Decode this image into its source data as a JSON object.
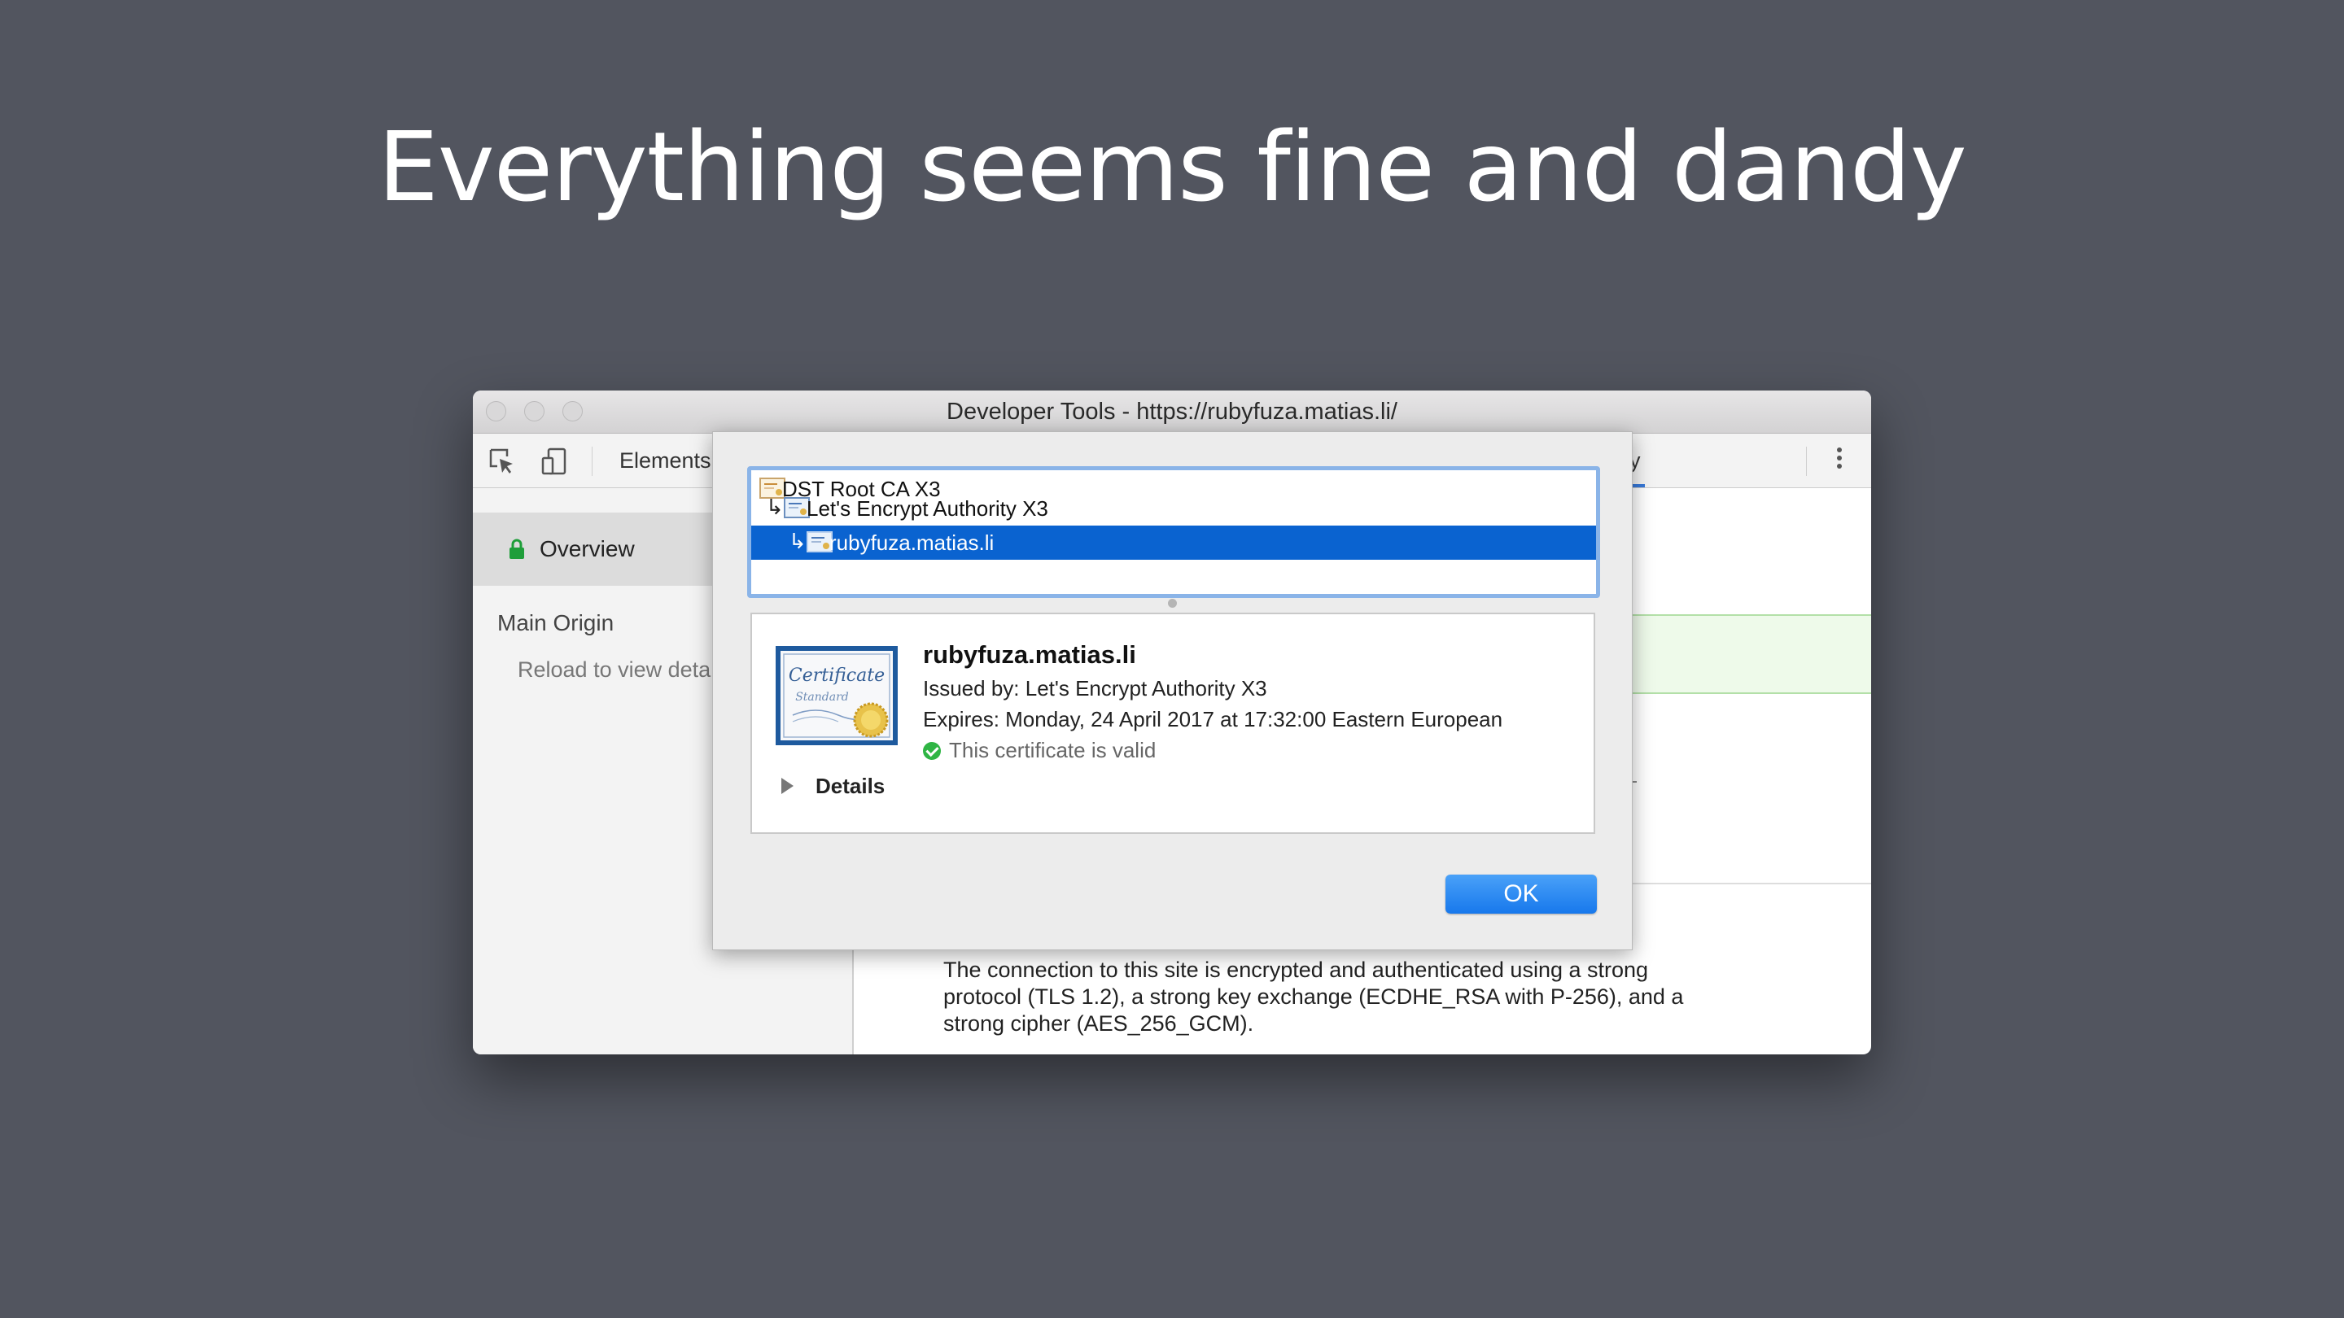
{
  "slide": {
    "title": "Everything seems fine and dandy"
  },
  "window": {
    "title": "Developer Tools - https://rubyfuza.matias.li/"
  },
  "toolbar": {
    "elements_tab": "Elements",
    "security_tab_partial": "y"
  },
  "sidebar": {
    "overview": "Overview",
    "main_origin": "Main Origin",
    "reload_text": "Reload to view deta"
  },
  "content": {
    "connection_text": "The connection to this site is encrypted and authenticated using a strong protocol (TLS 1.2), a strong key exchange (ECDHE_RSA with P-256), and a strong cipher (AES_256_GCM)."
  },
  "certificate": {
    "chain": [
      {
        "name": "DST Root CA X3",
        "arrow": ""
      },
      {
        "name": "Let's Encrypt Authority X3",
        "arrow": "↳"
      },
      {
        "name": "rubyfuza.matias.li",
        "arrow": "↳"
      }
    ],
    "selected_index": 2,
    "icon_text": {
      "line1": "Certificate",
      "line2": "Standard"
    },
    "name": "rubyfuza.matias.li",
    "issued_by": "Issued by: Let's Encrypt Authority X3",
    "expires": "Expires: Monday, 24 April 2017 at 17:32:00 Eastern European",
    "valid": "This certificate is valid",
    "details_label": "Details",
    "ok_label": "OK"
  },
  "colors": {
    "background": "#52555f",
    "selection": "#0a63d0",
    "valid_green": "#2fb544",
    "ok_button": "#1778ec"
  }
}
